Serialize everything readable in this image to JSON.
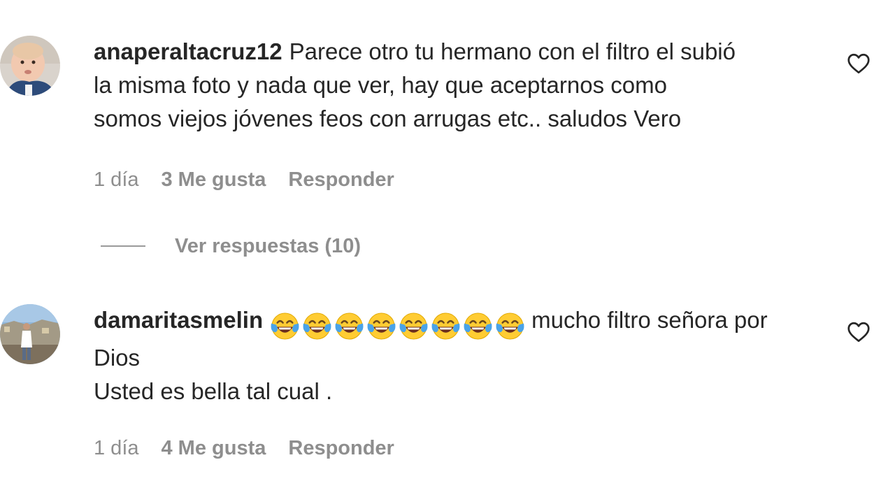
{
  "comments": [
    {
      "username": "anaperaltacruz12",
      "lines": [
        "Parece otro tu hermano con el filtro el subió",
        "la misma foto y nada que ver, hay que aceptarnos como",
        "somos viejos jóvenes feos con arrugas etc.. saludos Vero"
      ],
      "time": "1 día",
      "likes": "3 Me gusta",
      "reply": "Responder",
      "view_replies": "Ver respuestas (10)"
    },
    {
      "username": "damaritasmelin",
      "emoji_count": 8,
      "emoji_name": "face-with-tears-of-joy-icon",
      "lines": [
        "mucho filtro señora por",
        "Dios",
        "Usted es bella tal cual ."
      ],
      "time": "1 día",
      "likes": "4 Me gusta",
      "reply": "Responder"
    }
  ],
  "colors": {
    "text": "#262626",
    "secondary": "#8e8e8e",
    "emoji_face": "#FFCC33",
    "emoji_tears": "#4AA3E8"
  }
}
